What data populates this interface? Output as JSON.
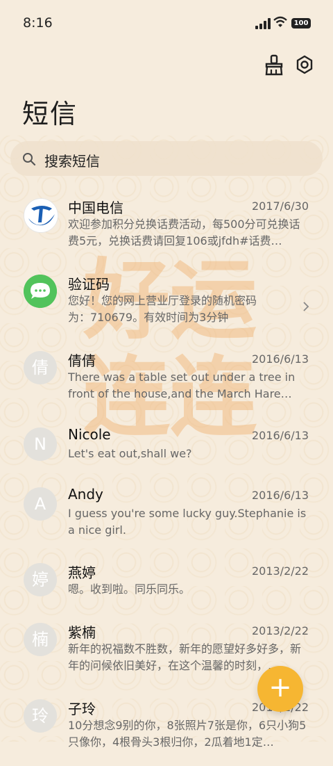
{
  "status": {
    "time": "8:16",
    "battery": "100"
  },
  "header": {
    "title": "短信"
  },
  "search": {
    "placeholder": "搜索短信"
  },
  "watermark": {
    "line1": "好运",
    "line2": "连连"
  },
  "messages": [
    {
      "name": "中国电信",
      "date": "2017/6/30",
      "preview": "欢迎参加积分兑换话费活动，每500分可兑换话费5元，兑换话费请回复106或jfdh#话费…",
      "avatar": "china-telecom-logo"
    },
    {
      "name": "验证码",
      "date": "",
      "preview": "您好！您的网上营业厅登录的随机密码为：710679。有效时间为3分钟",
      "avatar": "message-bubble-icon"
    },
    {
      "name": "倩倩",
      "date": "2016/6/13",
      "preview": "There was a table set out under a tree in front of the house,and the March Hare an…",
      "avatar": "倩"
    },
    {
      "name": "Nicole",
      "date": "2016/6/13",
      "preview": "Let's eat out,shall we?",
      "avatar": "N"
    },
    {
      "name": "Andy",
      "date": "2016/6/13",
      "preview": "I guess you're some lucky guy.Stephanie is a nice girl.",
      "avatar": "A"
    },
    {
      "name": "燕婷",
      "date": "2013/2/22",
      "preview": "嗯。收到啦。同乐同乐。",
      "avatar": "婷"
    },
    {
      "name": "紫楠",
      "date": "2013/2/22",
      "preview": "新年的祝福数不胜数，新年的愿望好多好多，新年的问候依旧美好，在这个温馨的时刻，…",
      "avatar": "楠"
    },
    {
      "name": "子玲",
      "date": "2013/2/22",
      "preview": "10分想念9别的你，8张照片7张是你，6只小狗5只像你，4根骨头3根归你，2瓜着地1定…",
      "avatar": "玲"
    }
  ],
  "colors": {
    "accent": "#f6b632",
    "background": "#f6ecdd"
  }
}
